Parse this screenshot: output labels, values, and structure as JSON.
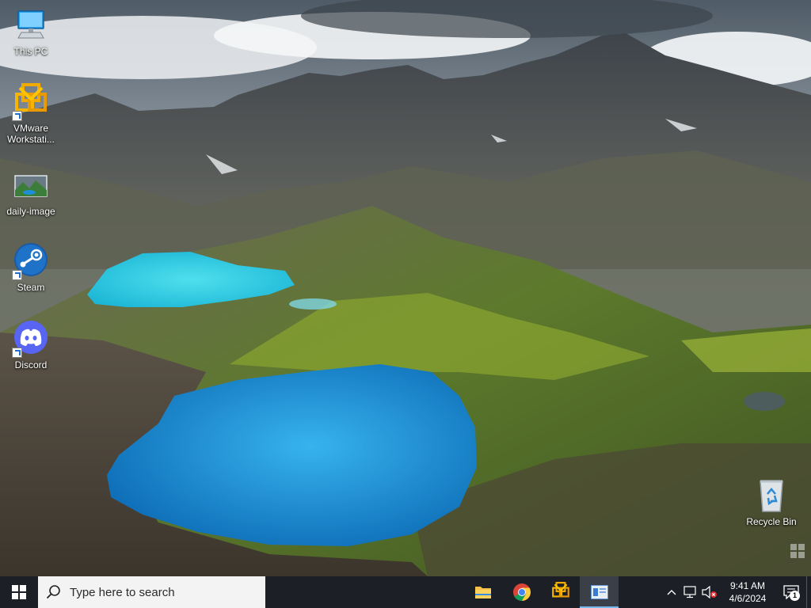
{
  "desktop": {
    "icons": [
      {
        "label": "This PC",
        "icon": "computer-icon"
      },
      {
        "label": "VMware Workstati...",
        "icon": "vmware-icon"
      },
      {
        "label": "daily-image",
        "icon": "image-file-icon"
      },
      {
        "label": "Steam",
        "icon": "steam-icon"
      },
      {
        "label": "Discord",
        "icon": "discord-icon"
      },
      {
        "label": "Recycle Bin",
        "icon": "recycle-bin-icon"
      }
    ]
  },
  "taskbar": {
    "start_icon": "windows-logo-icon",
    "search_placeholder": "Type here to search",
    "pinned_apps": [
      {
        "name": "File Explorer",
        "icon": "folder-icon",
        "active": false
      },
      {
        "name": "Google Chrome",
        "icon": "chrome-icon",
        "active": false
      },
      {
        "name": "VMware Workstation",
        "icon": "vmware-icon",
        "active": false
      },
      {
        "name": "Window app",
        "icon": "window-app-icon",
        "active": true
      }
    ],
    "tray": {
      "time": "9:41 AM",
      "date": "4/6/2024",
      "notification_count": "1",
      "icons": [
        "chevron-up-icon",
        "network-icon",
        "volume-muted-icon",
        "notification-icon"
      ]
    }
  },
  "colors": {
    "taskbar_bg": "#1c2026",
    "accent": "#76b9ed",
    "lake": "#1f8fd6"
  }
}
